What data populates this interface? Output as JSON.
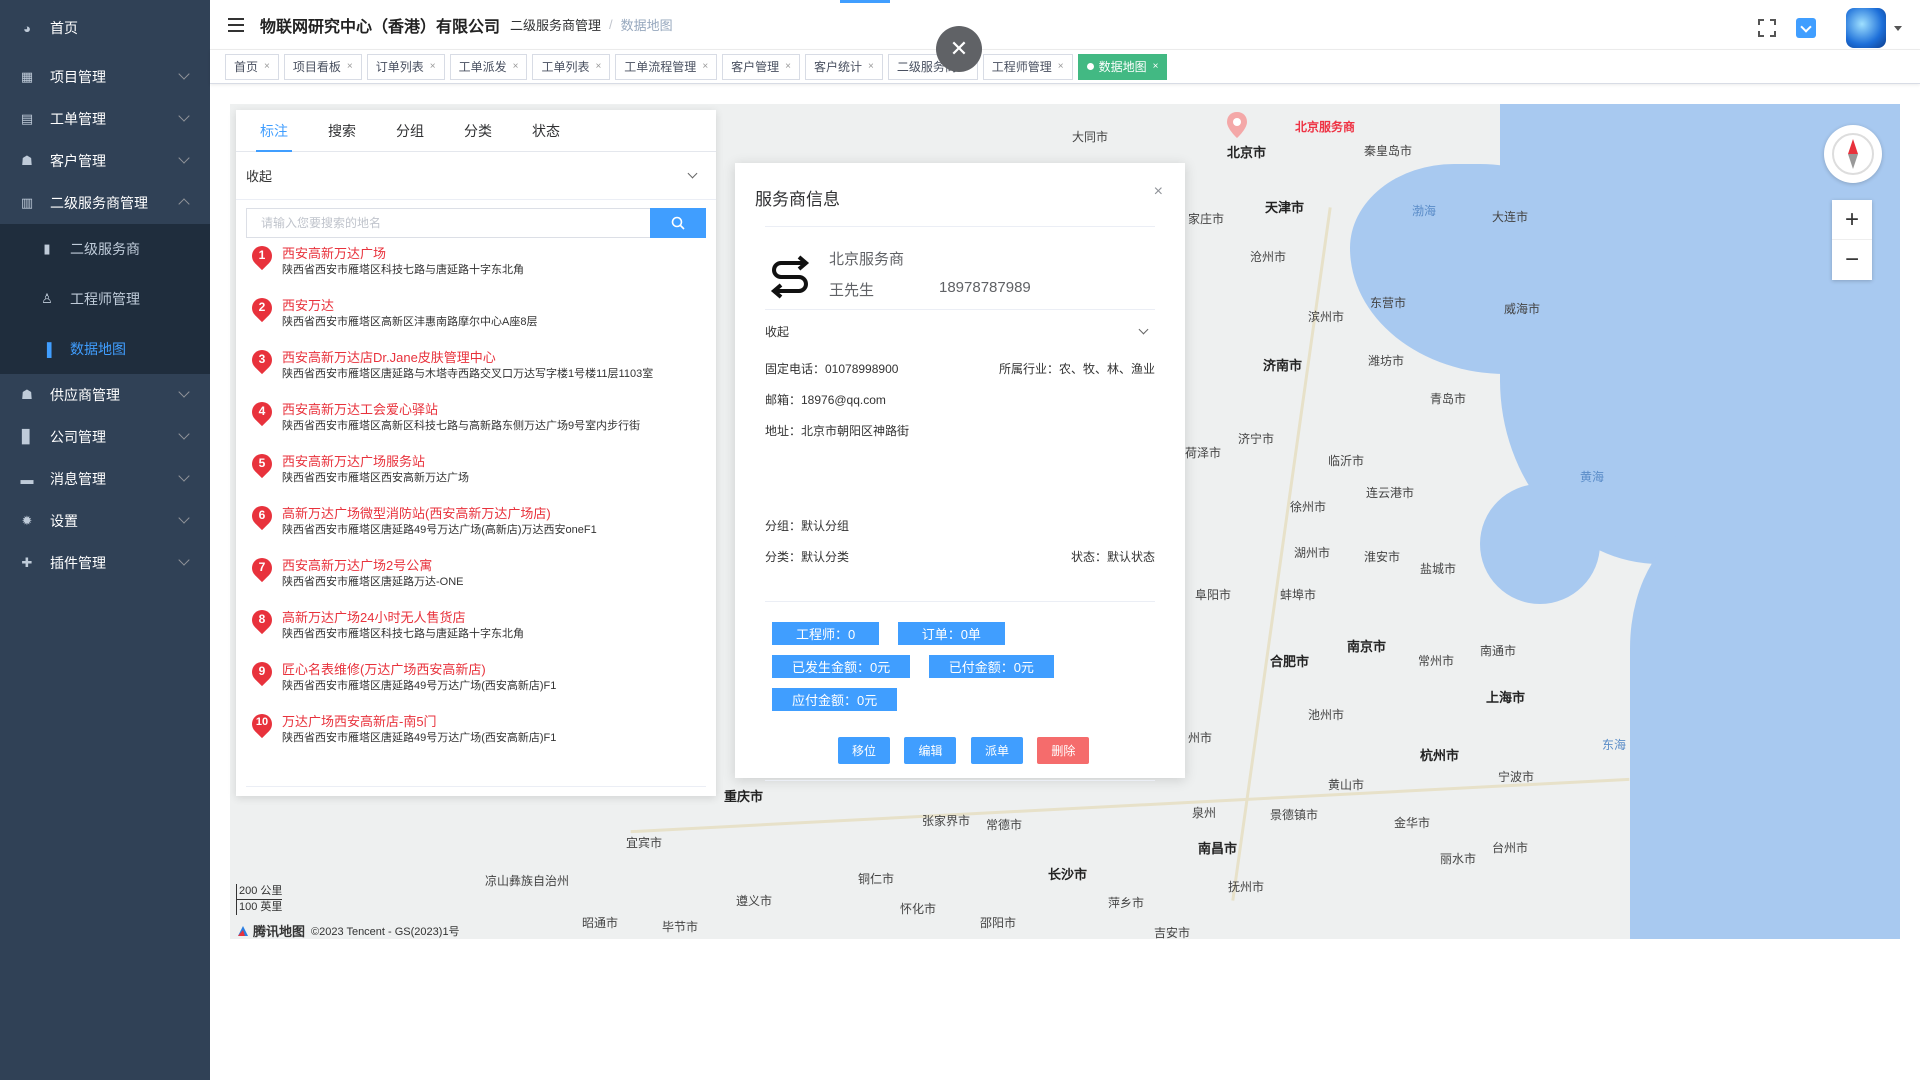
{
  "sidebar": {
    "items": [
      {
        "label": "首页",
        "icon": "dashboard-icon"
      },
      {
        "label": "项目管理",
        "icon": "project-icon"
      },
      {
        "label": "工单管理",
        "icon": "ticket-icon"
      },
      {
        "label": "客户管理",
        "icon": "customer-icon"
      },
      {
        "label": "二级服务商管理",
        "icon": "provider-icon"
      },
      {
        "label": "供应商管理",
        "icon": "supplier-icon"
      },
      {
        "label": "公司管理",
        "icon": "company-icon"
      },
      {
        "label": "消息管理",
        "icon": "message-icon"
      },
      {
        "label": "设置",
        "icon": "gear-icon"
      },
      {
        "label": "插件管理",
        "icon": "plugin-icon"
      }
    ],
    "sub_items": [
      {
        "label": "二级服务商",
        "icon": "list-icon"
      },
      {
        "label": "工程师管理",
        "icon": "user-icon"
      },
      {
        "label": "数据地图",
        "icon": "bar-chart-icon"
      }
    ]
  },
  "header": {
    "company": "物联网研究中心（香港）有限公司",
    "breadcrumb_parent": "二级服务商管理",
    "breadcrumb_separator": "/",
    "breadcrumb_current": "数据地图"
  },
  "tabs": [
    {
      "label": "首页"
    },
    {
      "label": "项目看板"
    },
    {
      "label": "订单列表"
    },
    {
      "label": "工单派发"
    },
    {
      "label": "工单列表"
    },
    {
      "label": "工单流程管理"
    },
    {
      "label": "客户管理"
    },
    {
      "label": "客户统计"
    },
    {
      "label": "二级服务商"
    },
    {
      "label": "工程师管理"
    },
    {
      "label": "数据地图"
    }
  ],
  "tab_close": "×",
  "close_fab": "✕",
  "left_panel": {
    "tabs": [
      "标注",
      "搜索",
      "分组",
      "分类",
      "状态"
    ],
    "collapse_label": "收起",
    "search_placeholder": "请输入您要搜索的地名",
    "results": [
      {
        "n": "1",
        "title": "西安高新万达广场",
        "addr": "陕西省西安市雁塔区科技七路与唐延路十字东北角"
      },
      {
        "n": "2",
        "title": "西安万达",
        "addr": "陕西省西安市雁塔区高新区沣惠南路摩尔中心A座8层"
      },
      {
        "n": "3",
        "title": "西安高新万达店Dr.Jane皮肤管理中心",
        "addr": "陕西省西安市雁塔区唐延路与木塔寺西路交叉口万达写字楼1号楼11层1103室"
      },
      {
        "n": "4",
        "title": "西安高新万达工会爱心驿站",
        "addr": "陕西省西安市雁塔区高新区科技七路与高新路东侧万达广场9号室内步行街"
      },
      {
        "n": "5",
        "title": "西安高新万达广场服务站",
        "addr": "陕西省西安市雁塔区西安高新万达广场"
      },
      {
        "n": "6",
        "title": "高新万达广场微型消防站(西安高新万达广场店)",
        "addr": "陕西省西安市雁塔区唐延路49号万达广场(高新店)万达西安oneF1"
      },
      {
        "n": "7",
        "title": "西安高新万达广场2号公寓",
        "addr": "陕西省西安市雁塔区唐延路万达-ONE"
      },
      {
        "n": "8",
        "title": "高新万达广场24小时无人售货店",
        "addr": "陕西省西安市雁塔区科技七路与唐延路十字东北角"
      },
      {
        "n": "9",
        "title": "匠心名表维修(万达广场西安高新店)",
        "addr": "陕西省西安市雁塔区唐延路49号万达广场(西安高新店)F1"
      },
      {
        "n": "10",
        "title": "万达广场西安高新店-南5门",
        "addr": "陕西省西安市雁塔区唐延路49号万达广场(西安高新店)F1"
      }
    ]
  },
  "info": {
    "title": "服务商信息",
    "close": "×",
    "name": "北京服务商",
    "contact": "王先生",
    "phone": "18978787989",
    "collapse_label": "收起",
    "landline": "固定电话：01078998900",
    "industry": "所属行业：农、牧、林、渔业",
    "email": "邮箱：18976@qq.com",
    "address": "地址：北京市朝阳区神路街",
    "group": "分组：默认分组",
    "category": "分类：默认分类",
    "status": "状态：默认状态",
    "stats": {
      "engineers": "工程师：0",
      "orders": "订单：0单",
      "incurred": "已发生金额：0元",
      "paid": "已付金额：0元",
      "payable": "应付金额：0元"
    },
    "buttons": {
      "move": "移位",
      "edit": "编辑",
      "dispatch": "派单",
      "delete": "删除"
    }
  },
  "map": {
    "provider_marker": "北京服务商",
    "cities": [
      "北京市",
      "天津市",
      "大同市",
      "秦皇岛市",
      "大连市",
      "渤海",
      "济南市",
      "威海市",
      "潍坊市",
      "青岛市",
      "滨州市",
      "东营市",
      "沧州市",
      "家庄市",
      "济宁市",
      "临沂市",
      "徐州市",
      "连云港市",
      "黄海",
      "淮安市",
      "盐城市",
      "阜阳市",
      "蚌埠市",
      "合肥市",
      "南京市",
      "常州市",
      "南通市",
      "上海市",
      "杭州市",
      "宁波市",
      "东海",
      "台州市",
      "丽水市",
      "金华市",
      "池州市",
      "黄山市",
      "景德镇市",
      "南昌市",
      "抚州市",
      "长沙市",
      "常德市",
      "张家界市",
      "重庆市",
      "宜宾市",
      "遵义市",
      "铜仁市",
      "怀化市",
      "萍乡市",
      "邵阳市",
      "昭通市",
      "毕节市",
      "吉安市",
      "凉山彝族自治州",
      "湖州市",
      "州市",
      "荷泽市",
      "泉州"
    ],
    "scale_km": "200 公里",
    "scale_mi": "100 英里",
    "logo": "腾讯地图",
    "copyright": "©2023 Tencent - GS(2023)1号",
    "zoom_in": "+",
    "zoom_out": "−"
  },
  "colors": {
    "primary": "#409eff",
    "danger": "#f56c6c",
    "success": "#42b983",
    "sidebar": "#304156",
    "pin": "#e8323c"
  }
}
